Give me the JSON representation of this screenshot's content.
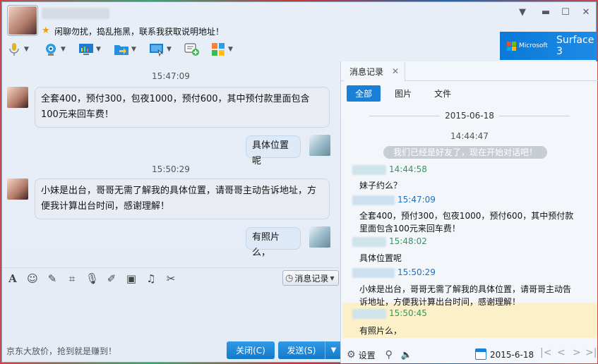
{
  "window": {
    "signature_star": "★",
    "signature": "闲聊勿扰，捣乱拖黑，联系我获取说明地址！",
    "controls": {
      "pin": "▼",
      "minimize": "▬",
      "maximize": "☐",
      "close": "✕"
    }
  },
  "ad": {
    "brand": "Microsoft",
    "product": "Surface 3"
  },
  "toolbar": {
    "icons": [
      "microphone-icon",
      "video-call-icon",
      "remote-screen-icon",
      "send-file-icon",
      "share-screen-icon",
      "add-user-icon",
      "apps-icon"
    ]
  },
  "chat": {
    "messages": [
      {
        "time": "15:47:09",
        "from": "her",
        "text1": "全套400，预付300，包夜1000，预付600，其中预付款里面包含",
        "text2": "100元来回车费！"
      },
      {
        "from": "me",
        "text": "具体位置呢"
      },
      {
        "time": "15:50:29",
        "from": "her",
        "text1": "小妹是出台，哥哥无需了解我的具体位置，请哥哥主动告诉地址，方",
        "text2": "便我计算出台时间，感谢理解！"
      },
      {
        "from": "me",
        "text": "有照片么，"
      }
    ]
  },
  "format_toolbar": {
    "icons": [
      "font-icon",
      "emoji-icon",
      "nudge-icon",
      "screenshot-icon",
      "voice-message-icon",
      "edit-icon",
      "image-icon",
      "music-icon",
      "scissors-icon"
    ],
    "history_button": "消息记录"
  },
  "footer": {
    "promo": "京东大放价，抢到就是赚到！",
    "close_button": "关闭(C)",
    "send_button": "发送(S)",
    "send_dropdown": "▼"
  },
  "history_panel": {
    "tab_label": "消息记录",
    "tab_close": "✕",
    "filters": [
      "全部",
      "图片",
      "文件"
    ],
    "date": "2015-06-18",
    "system_time": "14:44:47",
    "system_msg": "我们已经是好友了，现在开始对话吧！",
    "entries": [
      {
        "time": "14:44:58",
        "sender": "her",
        "text1": "妹子约么？",
        "text2": ""
      },
      {
        "time": "15:47:09",
        "sender": "me",
        "text1": "全套400，预付300，包夜1000，预付600，其中预付款",
        "text2": "里面包含100元来回车费！"
      },
      {
        "time": "15:48:02",
        "sender": "her",
        "text1": "具体位置呢",
        "text2": ""
      },
      {
        "time": "15:50:29",
        "sender": "me",
        "text1": "小妹是出台，哥哥无需了解我的具体位置，请哥哥主动告",
        "text2": "诉地址，方便我计算出台时间，感谢理解！"
      },
      {
        "time": "15:50:45",
        "sender": "her",
        "text1": "有照片么，",
        "text2": ""
      }
    ],
    "settings_label": "设置",
    "date_picker": "2015-6-18",
    "nav": {
      "first": "|<",
      "prev": "<",
      "next": ">",
      "last": ">|"
    }
  }
}
